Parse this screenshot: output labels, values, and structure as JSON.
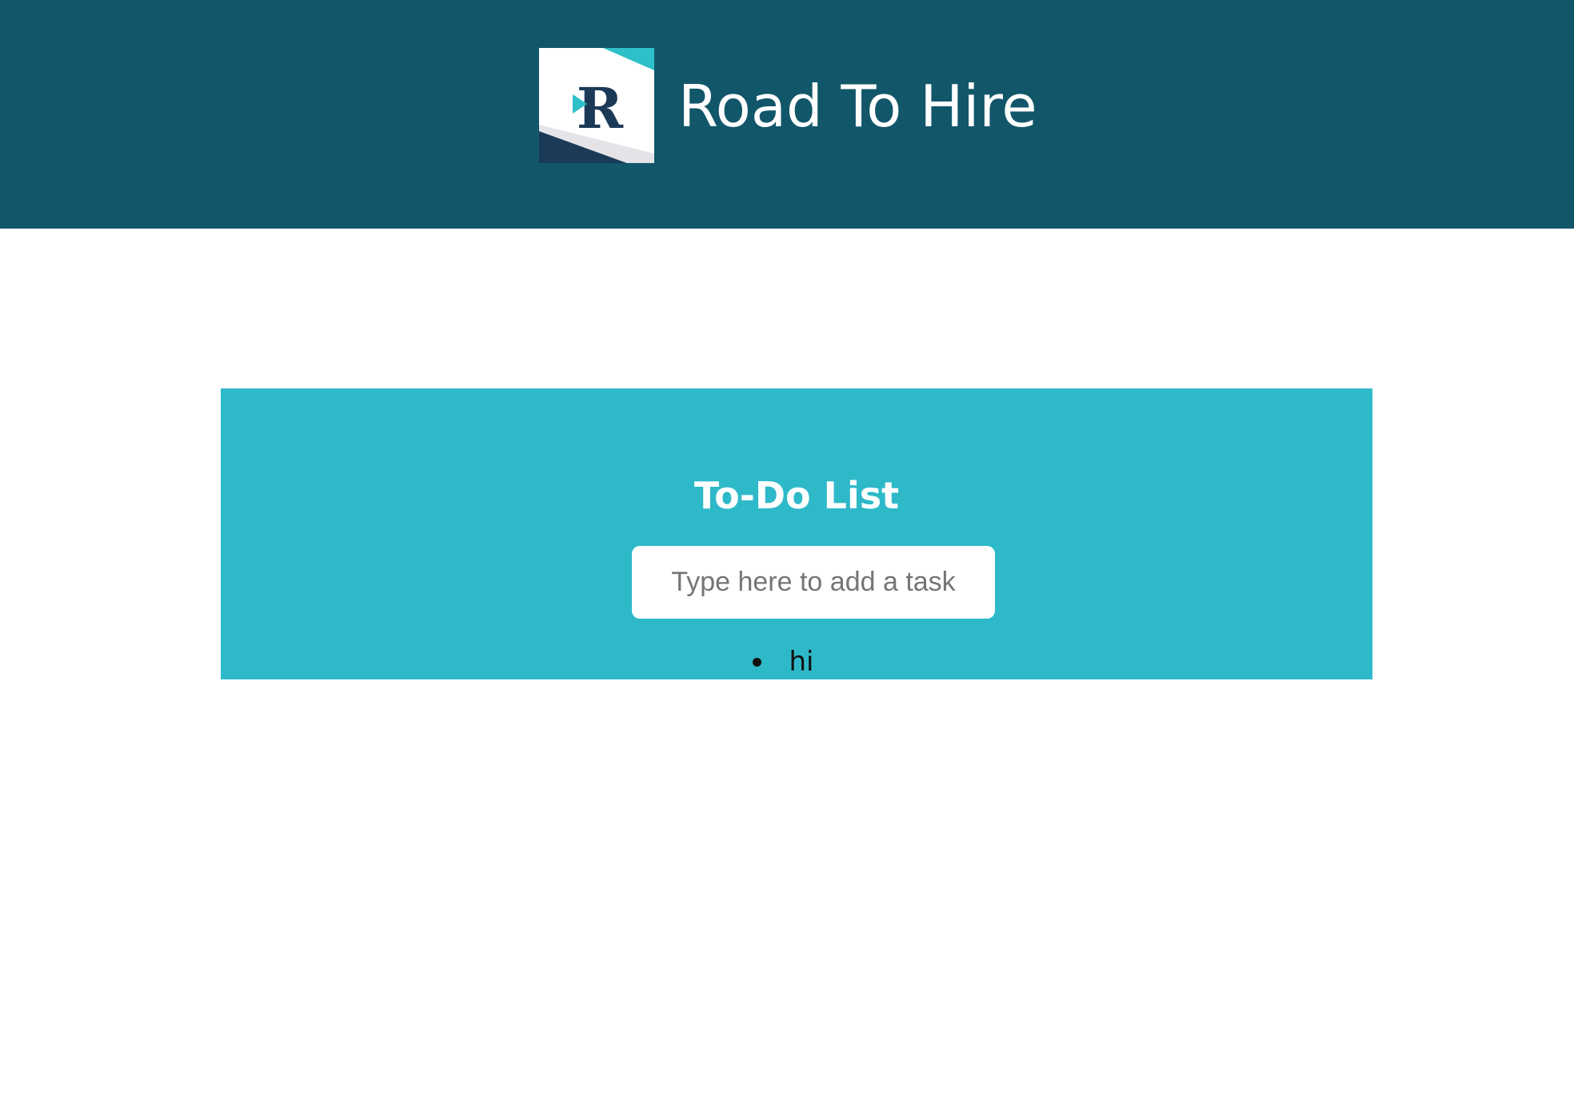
{
  "header": {
    "title": "Road To Hire",
    "logo_icon": "road-to-hire-logo",
    "background_color": "#12566a"
  },
  "todo": {
    "title": "To-Do List",
    "input": {
      "placeholder": "Type here to add a task",
      "value": ""
    },
    "tasks": [
      {
        "label": "hi"
      }
    ],
    "background_color": "#2eb9c9"
  }
}
